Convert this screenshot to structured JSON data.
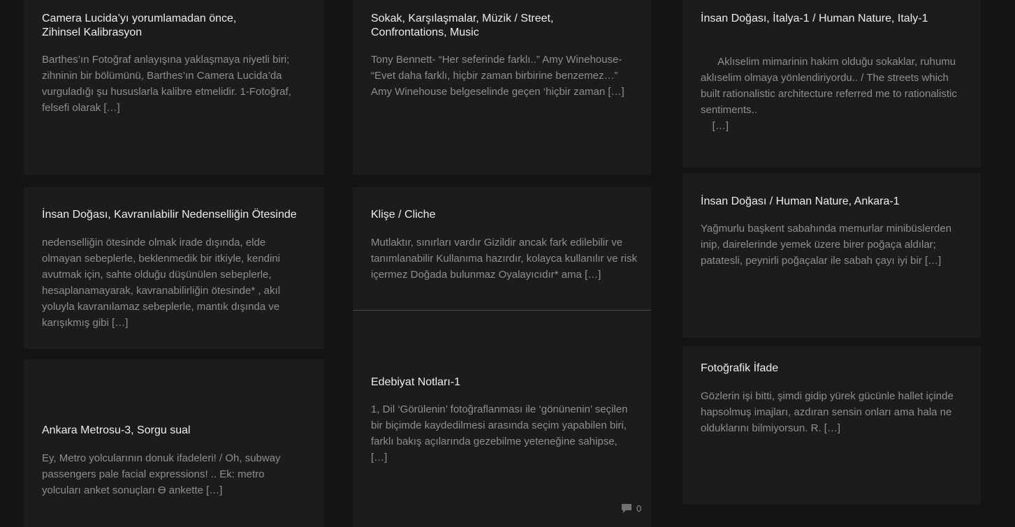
{
  "posts": [
    {
      "title": "Camera Lucida’yı yorumlamadan önce, Zihinsel Kalibrasyon",
      "excerpt": "Barthes’ın Fotoğraf anlayışına yaklaşmaya niyetli biri; zihninin bir bölümünü, Barthes’ın Camera Lucida’da vurguladığı şu hususlarla kalibre etmelidir. 1-Fotoğraf, felsefi olarak",
      "more": "[…]"
    },
    {
      "title": "Sokak, Karşılaşmalar, Müzik / Street, Confrontations, Music",
      "excerpt": "Tony Bennett- “Her seferinde farklı..” Amy Winehouse- “Evet daha farklı, hiçbir zaman birbirine benzemez…” Amy Winehouse belgeselinde geçen ‘hiçbir zaman",
      "more": "[…]"
    },
    {
      "title": "İnsan Doğası, İtalya-1 / Human Nature, Italy-1",
      "excerpt": "  Aklıselim mimarinin hakim olduğu sokaklar, ruhumu aklıselim olmaya yönlendiriyordu.. / The streets which built rationalistic architecture referred me to rationalistic sentiments..",
      "more": "[…]"
    },
    {
      "title": "İnsan Doğası, Kavranılabilir Nedenselliğin Ötesinde",
      "excerpt": "nedenselliğin ötesinde olmak irade dışında, elde olmayan sebeplerle, beklenmedik bir itkiyle, kendini avutmak için, sahte olduğu düşünülen sebeplerle, hesaplanamayarak, kavranabilirliğin ötesinde* , akıl yoluyla kavranılamaz sebeplerle, mantık dışında ve karışıkmış gibi",
      "more": "[…]"
    },
    {
      "title": "Klişe / Cliche",
      "excerpt": "Mutlaktır, sınırları vardır Gizildir ancak fark edilebilir ve tanımlanabilir Kullanıma hazırdır, kolayca kullanılır ve risk içermez Doğada bulunmaz Oyalayıcıdır* ama",
      "more": "[…]"
    },
    {
      "title": "İnsan Doğası / Human Nature, Ankara-1",
      "excerpt": "Yağmurlu başkent sabahında memurlar minibüslerden inip, dairelerinde yemek üzere birer poğaça aldılar; patatesli, peynirli poğaçalar ile sabah çayı iyi bir",
      "more": "[…]"
    },
    {
      "title": "Edebiyat Notları-1",
      "excerpt": "1, Dil ‘Görülenin’ fotoğraflanması ile ‘gönünenin’ seçilen bir biçimde kaydedilmesi arasında seçim yapabilen biri, farklı bakış açılarında gezebilme yeteneğine sahipse,",
      "more": "[…]"
    },
    {
      "title": "Fotoğrafik İfade",
      "excerpt": "Gözlerin işi bitti, şimdi gidip yürek gücünle hallet içinde hapsolmuş imajları, azdıran sensin onları ama hala ne olduklarını bilmiyorsun. R.",
      "more": "[…]"
    },
    {
      "title": "Ankara Metrosu-3, Sorgu sual",
      "excerpt": "Ey, Metro yolcularının donuk ifadeleri! / Oh, subway passengers pale facial expressions! .. Ek: metro yolcuları anket sonuçları ϴ ankette",
      "more": "[…]"
    }
  ],
  "comments": {
    "icon": "comment-icon",
    "count": "0"
  },
  "colors": {
    "background": "#141414",
    "card": "#1c1c1c",
    "title": "#ededed",
    "excerpt": "#8b8f93"
  }
}
